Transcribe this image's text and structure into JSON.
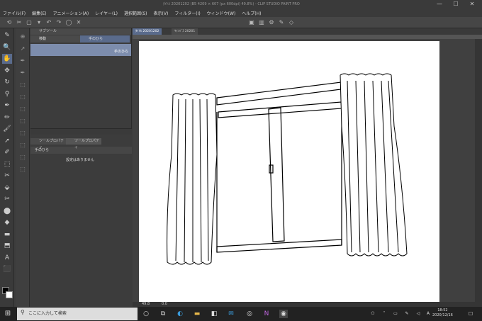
{
  "title_bar": {
    "title": "ﾀｲﾄﾙ 20201202 (B5 4209 × 607 (px 600dpi) 49.8%) - CLIP STUDIO PAINT PRO",
    "min": "—",
    "max": "☐",
    "close": "✕"
  },
  "menu": [
    "ファイル(F)",
    "編集(E)",
    "アニメーション(A)",
    "レイヤー(L)",
    "選択範囲(S)",
    "表示(V)",
    "フィルター(I)",
    "ウィンドウ(W)",
    "ヘルプ(H)"
  ],
  "command_icons": [
    "⟲",
    "✂",
    "▢",
    "▾",
    "↶",
    "↷",
    "◯",
    "✕",
    "▣",
    "▥",
    "⚙",
    "✎",
    "◇"
  ],
  "tools": [
    "✎",
    "🔍",
    "✋",
    "✥",
    "↻",
    "⚲",
    "✒",
    "✏",
    "🖌",
    "➚",
    "✐",
    "⬚",
    "✂",
    "⬙",
    "✂",
    "⬤",
    "◆",
    "▬",
    "⬒",
    "A",
    "⬛"
  ],
  "sub_tools": [
    "⊕",
    "↗",
    "✒",
    "✒",
    "⬚",
    "⬚",
    "⬚",
    "⬚",
    "⬚",
    "⬚",
    "⬚",
    "⬚"
  ],
  "sub_tool_panel": {
    "tab": "サブツール",
    "group": "移動",
    "group_active": "手のひら",
    "item": "手のひら"
  },
  "property_panel": {
    "tab1": "ツールプロパティ",
    "tab2": "ツールプロパティ",
    "tool_name": "手のひら",
    "empty_message": "設定はありません"
  },
  "doc_tabs": [
    {
      "label": "ﾀｲﾄﾙ 20201202"
    },
    {
      "label": "ｷｬﾝﾊﾞｽ 20201"
    }
  ],
  "zoom": {
    "value": "49.8",
    "angle": "0.0"
  },
  "taskbar": {
    "search_placeholder": "ここに入力して検索",
    "time": "18:52",
    "date": "2020/12/16",
    "ime": "A"
  },
  "colors": {
    "accent": "#5a6b8c",
    "canvas": "#ffffff",
    "panel": "#3c3c3c"
  }
}
